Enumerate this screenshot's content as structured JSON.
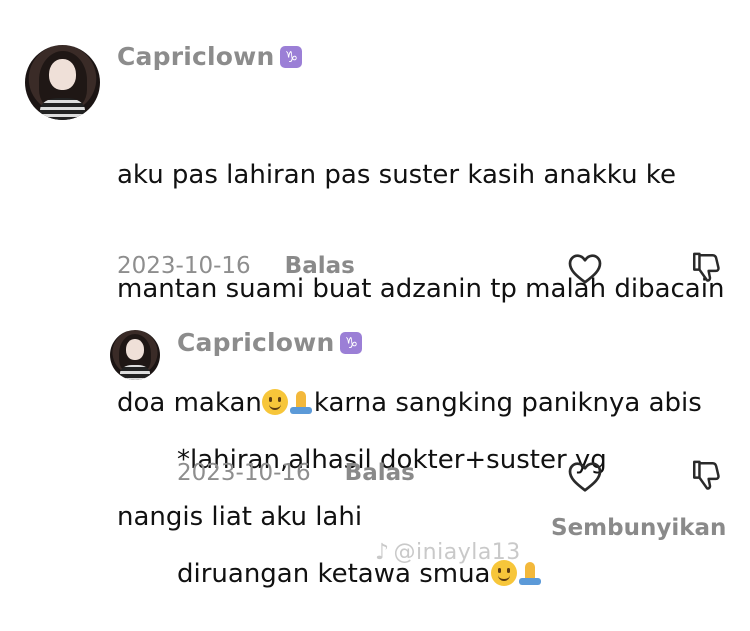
{
  "comment": {
    "username": "Capriclown",
    "zodiac_symbol": "♑",
    "text_line1": "aku pas lahiran pas suster kasih anakku ke",
    "text_line2": "mantan suami buat adzanin tp malah dibacain",
    "text_line3_a": "doa makan",
    "text_line3_b": "karna sangking paniknya abis",
    "text_line4": "nangis liat aku lahi",
    "date": "2023-10-16",
    "reply_label": "Balas"
  },
  "reply": {
    "username": "Capriclown",
    "zodiac_symbol": "♑",
    "text_line1": "*lahiran,alhasil dokter+suster yg",
    "text_line2": "diruangan ketawa smua",
    "date": "2023-10-16",
    "reply_label": "Balas"
  },
  "hide_replies_label": "Sembunyikan",
  "watermark": {
    "icon": "tiktok-icon",
    "text": "@iniayla13"
  },
  "colors": {
    "meta_gray": "#8e8e8e",
    "zodiac_badge": "#9b7fd6"
  }
}
